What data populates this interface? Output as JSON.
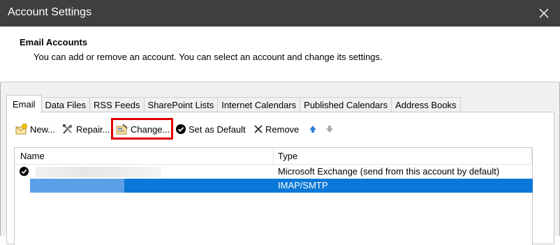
{
  "window": {
    "title": "Account Settings",
    "close_icon": "close-icon"
  },
  "header": {
    "title": "Email Accounts",
    "description": "You can add or remove an account. You can select an account and change its settings."
  },
  "tabs": [
    {
      "label": "Email",
      "active": true
    },
    {
      "label": "Data Files"
    },
    {
      "label": "RSS Feeds"
    },
    {
      "label": "SharePoint Lists"
    },
    {
      "label": "Internet Calendars"
    },
    {
      "label": "Published Calendars"
    },
    {
      "label": "Address Books"
    }
  ],
  "toolbar": {
    "new_label": "New...",
    "repair_label": "Repair...",
    "change_label": "Change...",
    "set_default_label": "Set as Default",
    "remove_label": "Remove",
    "highlight_color": "#e00000"
  },
  "list": {
    "columns": {
      "name": "Name",
      "type": "Type"
    },
    "rows": [
      {
        "name": "",
        "type": "Microsoft Exchange (send from this account by default)",
        "default": true,
        "selected": false
      },
      {
        "name": "",
        "type": "IMAP/SMTP",
        "default": false,
        "selected": true
      }
    ],
    "selection_color": "#0b78d7"
  }
}
